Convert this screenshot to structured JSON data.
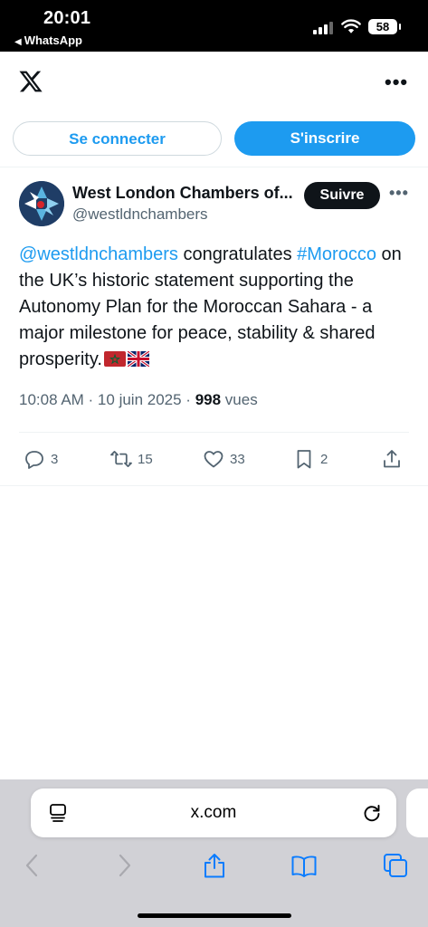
{
  "status_bar": {
    "time": "20:01",
    "back_app": "WhatsApp",
    "battery": "58"
  },
  "header": {
    "logo_icon": "x-logo-icon",
    "more_label": "•••"
  },
  "auth": {
    "login_label": "Se connecter",
    "signup_label": "S'inscrire"
  },
  "tweet": {
    "author_name": "West London Chambers of...",
    "author_handle": "@westldnchambers",
    "follow_label": "Suivre",
    "more_label": "•••",
    "text": {
      "mention": "@westldnchambers",
      "part1": " congratulates ",
      "hashtag": "#Morocco",
      "part2": " on the UK’s historic statement supporting the Autonomy Plan for the Moroccan Sahara - a major milestone for peace, stability & shared prosperity."
    },
    "flags": [
      "flag-morocco-icon",
      "flag-uk-icon"
    ],
    "timestamp": "10:08 AM · 10 juin 2025 · ",
    "views_count": "998",
    "views_label": " vues",
    "actions": {
      "replies": "3",
      "reposts": "15",
      "likes": "33",
      "bookmarks": "2"
    }
  },
  "browser": {
    "url": "x.com"
  },
  "colors": {
    "accent": "#1d9bf0",
    "text_primary": "#0f1419",
    "text_secondary": "#536471",
    "divider": "#eff3f4",
    "safari_bar": "#d1d1d6"
  }
}
